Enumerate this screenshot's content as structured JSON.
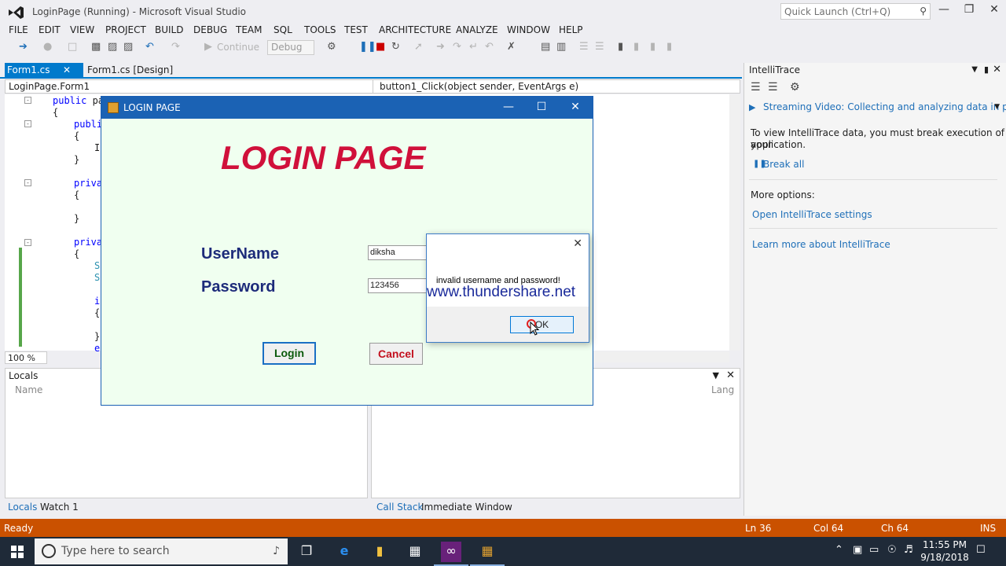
{
  "window": {
    "title": "LoginPage (Running) - Microsoft Visual Studio",
    "quick_launch_placeholder": "Quick Launch (Ctrl+Q)"
  },
  "menu": [
    "FILE",
    "EDIT",
    "VIEW",
    "PROJECT",
    "BUILD",
    "DEBUG",
    "TEAM",
    "SQL",
    "TOOLS",
    "TEST",
    "ARCHITECTURE",
    "ANALYZE",
    "WINDOW",
    "HELP"
  ],
  "toolbar": {
    "continue_label": "Continue",
    "config_value": "Debug"
  },
  "doc_tabs": {
    "active": "Form1.cs",
    "other": "Form1.cs [Design]"
  },
  "navbar": {
    "type": "LoginPage.Form1",
    "member": "button1_Click(object sender, EventArgs e)"
  },
  "code": {
    "l1_kw": "public",
    "l1_rest": " pa",
    "l2": "{",
    "l3_kw": "publi",
    "l4": "{",
    "l5": "I",
    "l6": "}",
    "l7_kw": "priva",
    "l8": "{",
    "l9": "}",
    "l10_kw": "priva",
    "l11": "{",
    "l12": "S",
    "l13": "S",
    "l14": "i",
    "l15": "{",
    "l16": "}",
    "l17": "e"
  },
  "editor": {
    "zoom": "100 %"
  },
  "locals": {
    "title": "Locals",
    "col_name": "Name",
    "col_lang": "Lang"
  },
  "bottom_tabs": {
    "locals": "Locals",
    "watch": "Watch 1",
    "callstack": "Call Stack",
    "immediate": "Immediate Window"
  },
  "intellitrace": {
    "title": "IntelliTrace",
    "video_link": "Streaming Video: Collecting and analyzing data in product",
    "info": "To view IntelliTrace data, you must break execution of your",
    "info2": "application.",
    "break_all": "Break all",
    "more_options": "More options:",
    "settings_link": "Open IntelliTrace settings",
    "learn_link": "Learn more about IntelliTrace"
  },
  "status": {
    "ready": "Ready",
    "ln": "Ln 36",
    "col": "Col 64",
    "ch": "Ch 64",
    "ins": "INS"
  },
  "taskbar": {
    "search_placeholder": "Type here to search",
    "time": "11:55 PM",
    "date": "9/18/2018"
  },
  "login_form": {
    "title": "LOGIN PAGE",
    "heading": "LOGIN PAGE",
    "username_label": "UserName",
    "password_label": "Password",
    "username_value": "diksha",
    "password_value": "123456",
    "login_button": "Login",
    "cancel_button": "Cancel"
  },
  "message_box": {
    "text": "invalid username and password!",
    "ok_button": "OK",
    "watermark": "www.thundershare.net"
  },
  "colors": {
    "accent": "#007acc",
    "status_bar": "#ca5100",
    "heading_red": "#d0103a",
    "label_blue": "#1d2b7a"
  }
}
